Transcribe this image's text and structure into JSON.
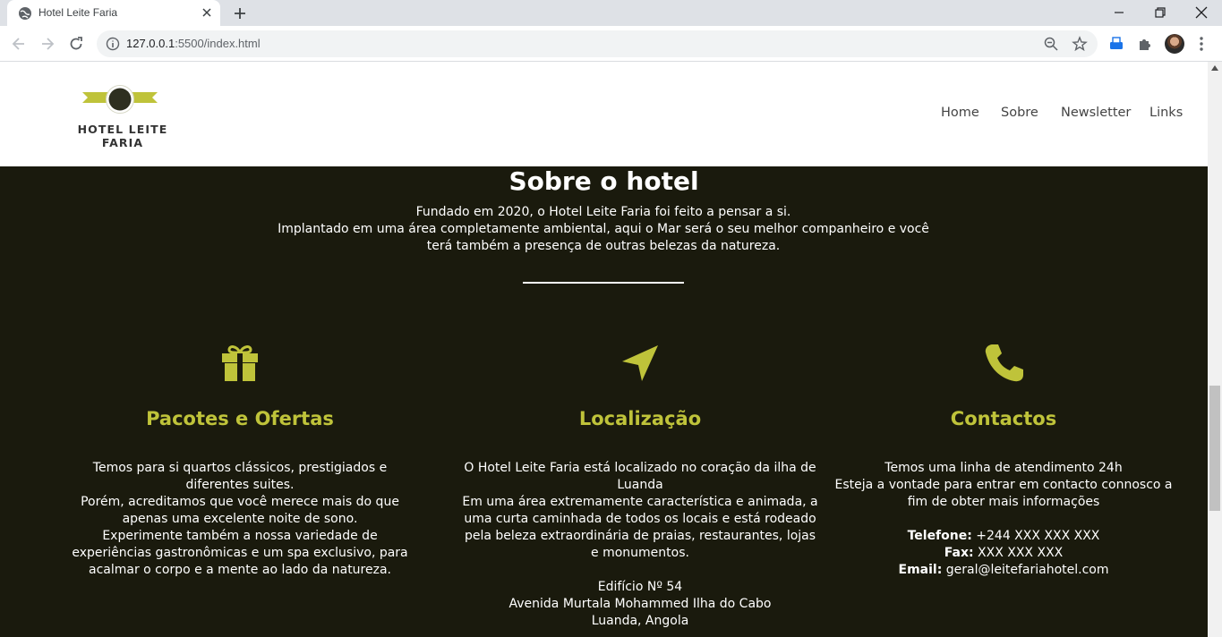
{
  "browser": {
    "tab_title": "Hotel Leite Faria",
    "url_host": "127.0.0.1",
    "url_rest": ":5500/index.html"
  },
  "header": {
    "logo_text": "HOTEL LEITE FARIA",
    "brand_colors": {
      "accent": "#bfc33a",
      "dark": "#2e2f20"
    },
    "nav": [
      "Home",
      "Sobre",
      "Newsletter",
      "Links"
    ]
  },
  "about": {
    "title": "Sobre o hotel",
    "lines": [
      "Fundado em 2020, o Hotel Leite Faria foi feito a pensar a si.",
      "Implantado em uma área completamente ambiental, aqui o Mar será o seu melhor companheiro e você terá também a presença de outras belezas da natureza."
    ]
  },
  "columns": [
    {
      "icon": "gift-icon",
      "title": "Pacotes e Ofertas",
      "paragraphs": [
        "Temos para si quartos clássicos, prestigiados e diferentes suites.",
        "Porém, acreditamos que você merece mais do que apenas uma excelente noite de sono.",
        "Experimente também a nossa variedade de experiências gastronômicas e um spa exclusivo, para acalmar o corpo e a mente ao lado da natureza."
      ]
    },
    {
      "icon": "location-arrow-icon",
      "title": "Localização",
      "paragraphs": [
        "O Hotel Leite Faria está localizado no coração da ilha de Luanda",
        "Em uma área extremamente característica e animada, a uma curta caminhada de todos os locais e está rodeado pela beleza extraordinária de praias, restaurantes, lojas e monumentos."
      ],
      "address": [
        "Edifício Nº 54",
        "Avenida Murtala Mohammed Ilha do Cabo",
        "Luanda, Angola"
      ]
    },
    {
      "icon": "phone-icon",
      "title": "Contactos",
      "paragraphs": [
        "Temos uma linha de atendimento 24h",
        "Esteja a vontade para entrar em contacto connosco a fim de obter mais informações"
      ],
      "contacts": [
        {
          "label": "Telefone:",
          "value": "+244 XXX XXX XXX"
        },
        {
          "label": "Fax:",
          "value": "XXX XXX XXX"
        },
        {
          "label": "Email:",
          "value": "geral@leitefariahotel.com"
        }
      ]
    }
  ]
}
